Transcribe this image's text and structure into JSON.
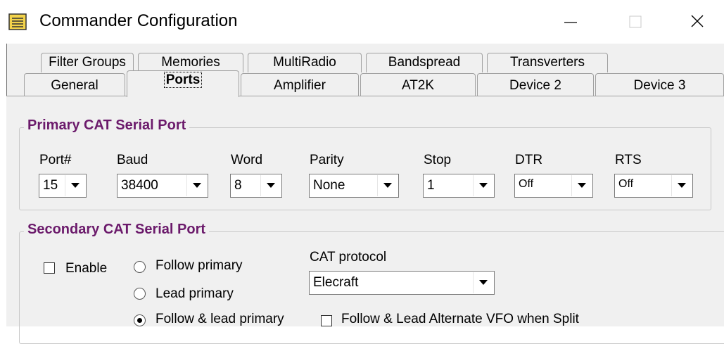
{
  "window": {
    "title": "Commander Configuration",
    "minimize_icon": "minimize-icon",
    "maximize_icon": "maximize-icon",
    "close_icon": "close-icon"
  },
  "tabs": {
    "row1": [
      {
        "label": "Filter Groups"
      },
      {
        "label": "Memories"
      },
      {
        "label": "MultiRadio"
      },
      {
        "label": "Bandspread"
      },
      {
        "label": "Transverters"
      }
    ],
    "row2": [
      {
        "label": "General"
      },
      {
        "label": "Ports",
        "selected": true
      },
      {
        "label": "Amplifier"
      },
      {
        "label": "AT2K"
      },
      {
        "label": "Device 2"
      },
      {
        "label": "Device 3"
      }
    ]
  },
  "primary": {
    "legend": "Primary CAT Serial Port",
    "fields": [
      {
        "label": "Port#",
        "value": "15"
      },
      {
        "label": "Baud",
        "value": "38400"
      },
      {
        "label": "Word",
        "value": "8"
      },
      {
        "label": "Parity",
        "value": "None"
      },
      {
        "label": "Stop",
        "value": "1"
      },
      {
        "label": "DTR",
        "value": "Off"
      },
      {
        "label": "RTS",
        "value": "Off"
      }
    ]
  },
  "secondary": {
    "legend": "Secondary CAT Serial Port",
    "enable_label": "Enable",
    "enable_checked": false,
    "radios": [
      {
        "label": "Follow primary",
        "checked": false
      },
      {
        "label": "Lead primary",
        "checked": false
      },
      {
        "label": "Follow & lead primary",
        "checked": true
      }
    ],
    "protocol_label": "CAT protocol",
    "protocol_value": "Elecraft",
    "alt_vfo_label": "Follow & Lead Alternate VFO when Split",
    "alt_vfo_checked": false
  },
  "colors": {
    "legend": "#6b1a6b",
    "dialog_bg": "#f0f0f0"
  }
}
